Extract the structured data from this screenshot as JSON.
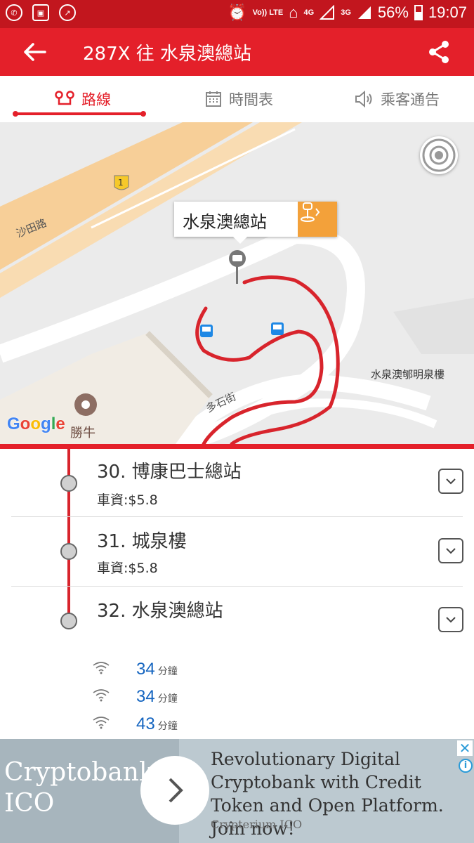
{
  "status_bar": {
    "network_4g": "4G",
    "network_3g": "3G",
    "volte": "Vo)) LTE",
    "battery": "56%",
    "time": "19:07"
  },
  "app_bar": {
    "title": "287X 往 水泉澳總站"
  },
  "tabs": [
    {
      "label": "路線",
      "icon": "route-icon",
      "active": true
    },
    {
      "label": "時間表",
      "icon": "calendar-icon",
      "active": false
    },
    {
      "label": "乘客通告",
      "icon": "speaker-icon",
      "active": false
    }
  ],
  "map": {
    "callout": "水泉澳總站",
    "road_label_1": "沙田路",
    "road_label_2": "多石街",
    "building_label": "水泉澳郇明泉樓",
    "shop_label": "勝牛",
    "route_shield": "1",
    "google_logo": "Google"
  },
  "stops": [
    {
      "name": "30. 博康巴士總站",
      "fare": "車資:$5.8"
    },
    {
      "name": "31. 城泉樓",
      "fare": "車資:$5.8"
    },
    {
      "name": "32. 水泉澳總站",
      "fare": ""
    }
  ],
  "eta": [
    {
      "minutes": "34",
      "unit": "分鐘"
    },
    {
      "minutes": "34",
      "unit": "分鐘"
    },
    {
      "minutes": "43",
      "unit": "分鐘"
    }
  ],
  "ad": {
    "brand": "Cryptobank ICO",
    "headline": "Revolutionary Digital Cryptobank with Credit Token and Open Platform. Join now!",
    "source": "Crypterium ICO",
    "close": "✕",
    "info": "i"
  },
  "colors": {
    "primary_red": "#e4202a",
    "status_red": "#c2161e",
    "eta_blue": "#1565c0",
    "callout_orange": "#f3a13a"
  }
}
